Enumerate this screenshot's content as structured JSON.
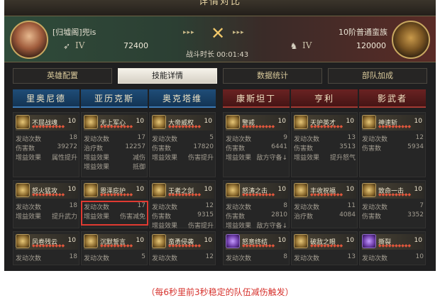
{
  "title": "详情对比",
  "left_player": {
    "name": "[归墟阁]兜is",
    "tier": "IV",
    "power": "72400"
  },
  "right_player": {
    "name": "10阶普通蛮族",
    "tier": "IV",
    "power": "120000"
  },
  "arrows": "▸▸▸",
  "battle_time": "战斗时长 00:01:43",
  "tabs": [
    {
      "label": "英雄配置"
    },
    {
      "label": "技能详情"
    },
    {
      "label": "数据统计"
    },
    {
      "label": "部队加成"
    }
  ],
  "heroes": [
    {
      "name": "里奥尼德"
    },
    {
      "name": "亚历克斯"
    },
    {
      "name": "奥克塔维"
    },
    {
      "name": "康斯坦丁"
    },
    {
      "name": "亨利"
    },
    {
      "name": "影武者"
    }
  ],
  "cards": [
    {
      "name": "不屈战魂",
      "level": "10",
      "stars": "◆◆◆◆◆◆◆◆◆◆",
      "stats": [
        {
          "k": "发动次数",
          "v": "18"
        },
        {
          "k": "伤害数",
          "v": "39272"
        },
        {
          "k": "增益效果",
          "v": "属性提升"
        }
      ]
    },
    {
      "name": "无上军心",
      "level": "10",
      "stars": "◆◆◆◆◆◆◆◆◆◆",
      "stats": [
        {
          "k": "发动次数",
          "v": "17"
        },
        {
          "k": "治疗数",
          "v": "12257"
        },
        {
          "k": "增益效果",
          "v": "减伤"
        },
        {
          "k": "增益效果",
          "v": "抵御"
        }
      ]
    },
    {
      "name": "大帝威权",
      "level": "10",
      "stars": "◆◆◆◆◆◆◆◆◆◆",
      "stats": [
        {
          "k": "发动次数",
          "v": "5"
        },
        {
          "k": "伤害数",
          "v": "17820"
        },
        {
          "k": "增益效果",
          "v": "伤害提升"
        }
      ]
    },
    {
      "name": "警戒",
      "level": "10",
      "stars": "◆◆◆◆◆◆◆◆◆◆",
      "stats": [
        {
          "k": "发动次数",
          "v": "9"
        },
        {
          "k": "伤害数",
          "v": "6441"
        },
        {
          "k": "增益效果",
          "v": "敌方守备↓"
        }
      ]
    },
    {
      "name": "天护英才",
      "level": "10",
      "stars": "◆◆◆◆◆◆◆◆◆◆",
      "stats": [
        {
          "k": "发动次数",
          "v": "13"
        },
        {
          "k": "伤害数",
          "v": "3513"
        },
        {
          "k": "增益效果",
          "v": "提升怒气"
        }
      ]
    },
    {
      "name": "神速斩",
      "level": "10",
      "stars": "◆◆◆◆◆◆◆◆◆◆",
      "stats": [
        {
          "k": "发动次数",
          "v": "12"
        },
        {
          "k": "伤害数",
          "v": "5934"
        }
      ]
    },
    {
      "name": "怒火猛攻",
      "level": "10",
      "stars": "◆◆◆◆◆◆◆◆◆◆",
      "stats": [
        {
          "k": "发动次数",
          "v": "18"
        },
        {
          "k": "增益效果",
          "v": "提升武力"
        }
      ]
    },
    {
      "name": "恩泽庇护",
      "level": "10",
      "stars": "◆◆◆◆◆◆◆◆◆◆",
      "stats": [
        {
          "k": "发动次数",
          "v": "17"
        },
        {
          "k": "增益效果",
          "v": "伤害减免"
        }
      ]
    },
    {
      "name": "王者之剑",
      "level": "10",
      "stars": "◆◆◆◆◆◆◆◆◆◆",
      "stats": [
        {
          "k": "发动次数",
          "v": "12"
        },
        {
          "k": "伤害数",
          "v": "9315"
        },
        {
          "k": "增益效果",
          "v": "伤害提升"
        }
      ]
    },
    {
      "name": "怒涛之击",
      "level": "10",
      "stars": "◆◆◆◆◆◆◆◆◆◆",
      "stats": [
        {
          "k": "发动次数",
          "v": "8"
        },
        {
          "k": "伤害数",
          "v": "2810"
        },
        {
          "k": "增益效果",
          "v": "敌方守备↓"
        }
      ]
    },
    {
      "name": "丰收祝福",
      "level": "10",
      "stars": "◆◆◆◆◆◆◆◆◆◆",
      "stats": [
        {
          "k": "发动次数",
          "v": "11"
        },
        {
          "k": "治疗数",
          "v": "4084"
        }
      ]
    },
    {
      "name": "致命一击",
      "level": "10",
      "stars": "◆◆◆◆◆◆◆◆◆◆",
      "stats": [
        {
          "k": "发动次数",
          "v": "7"
        },
        {
          "k": "伤害数",
          "v": "3352"
        }
      ]
    },
    {
      "name": "风卷残云",
      "level": "10",
      "stars": "◆◆◆◆◆◆◆◆◆◆",
      "stats": [
        {
          "k": "发动次数",
          "v": "18"
        }
      ]
    },
    {
      "name": "沉默誓言",
      "level": "10",
      "stars": "◆◆◆◆◆◆◆◆◆◆",
      "stats": [
        {
          "k": "发动次数",
          "v": "5"
        }
      ]
    },
    {
      "name": "蛮勇侵袭",
      "level": "10",
      "stars": "◆◆◆◆◆◆◆◆◆◆",
      "stats": [
        {
          "k": "发动次数",
          "v": "12"
        }
      ]
    },
    {
      "name": "怒意终结",
      "level": "10",
      "stars": "◆◆◆◆◆◆◆◆◆◆",
      "stats": [
        {
          "k": "发动次数",
          "v": "8"
        }
      ]
    },
    {
      "name": "破敌之眼",
      "level": "10",
      "stars": "◆◆◆◆◆◆◆◆◆◆",
      "stats": [
        {
          "k": "发动次数",
          "v": "13"
        }
      ]
    },
    {
      "name": "撕裂",
      "level": "10",
      "stars": "◆◆◆◆◆◆◆◆◆◆",
      "stats": [
        {
          "k": "发动次数",
          "v": "10"
        }
      ]
    }
  ],
  "caption": "（每6秒里前3秒稳定的队伍减伤触发）"
}
